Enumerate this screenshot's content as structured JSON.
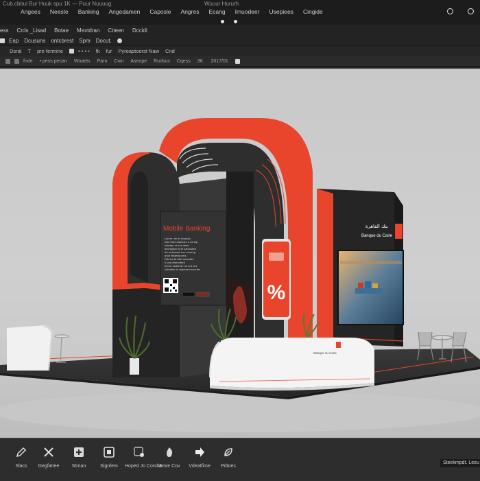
{
  "window": {
    "title_left": "Cub.cbbul Bur Huuk spu 1K — Puur Nuuuug",
    "title_center": "Wuuur Hururh"
  },
  "menu": [
    "Angees",
    "Neeste",
    "Banking",
    "Angedamen",
    "Caposle",
    "Angres",
    "Ecang",
    "Imuodeer",
    "Usepiees",
    "Cingide"
  ],
  "toolbar1": [
    "ess",
    "Crds _Lisad",
    "Botae",
    "Mextdran",
    "Ctteen",
    "Dccidi"
  ],
  "toolbar2": [
    "Eap",
    "Dcusuns",
    "ontcbrest",
    "Spm",
    "Docut."
  ],
  "toolbar3": [
    "Dsral",
    "T",
    "pre fermine",
    "•   •   •   •",
    "fk",
    "fur",
    "Pyroaptoerst Naw",
    "Cnd"
  ],
  "toolbar4": [
    "fnde",
    "• pess pecan",
    "Wnaets",
    "Parn",
    "Cwn",
    "Aseope",
    "Rudsus",
    "Cqess",
    "36.",
    "2017/01"
  ],
  "scene": {
    "panel_title": "Mobile Banking",
    "panel_lines": [
      "Lorem nisi el mosulis",
      "laes fomi doalcom o as olg",
      "ndinam nt a lo dere",
      "dnlcapton fo te aiecustee",
      "for enfromat con mereng",
      "onte festeesnerts",
      "Faturte fo oter amesten",
      "A voo dtenndent",
      "fen te asletiner ne nnt ont",
      "vidaldon to eppnesnl saurtes"
    ],
    "bank_name": "Banque du Caire",
    "bank_arabic": "بنك القاهرة",
    "percent_sign": "%",
    "counter_label": "Banque du Caire",
    "brand_orange": "#e8452c",
    "brand_dark": "#2e2e2e"
  },
  "tools": [
    {
      "label": "Slacs",
      "icon": "pencil-icon"
    },
    {
      "label": "Gegfattee",
      "icon": "tools-icon"
    },
    {
      "label": "Strnan",
      "icon": "plus-icon"
    },
    {
      "label": "Signfem",
      "icon": "select-icon"
    },
    {
      "label": "Hoped Jo Condte",
      "icon": "object-icon"
    },
    {
      "label": "Amre Cov",
      "icon": "fire-icon"
    },
    {
      "label": "Vdeatfime",
      "icon": "arrow-icon"
    },
    {
      "label": "Pdtoes",
      "icon": "leaf-icon"
    }
  ],
  "status_text": "Steekmpdt. Leeu"
}
